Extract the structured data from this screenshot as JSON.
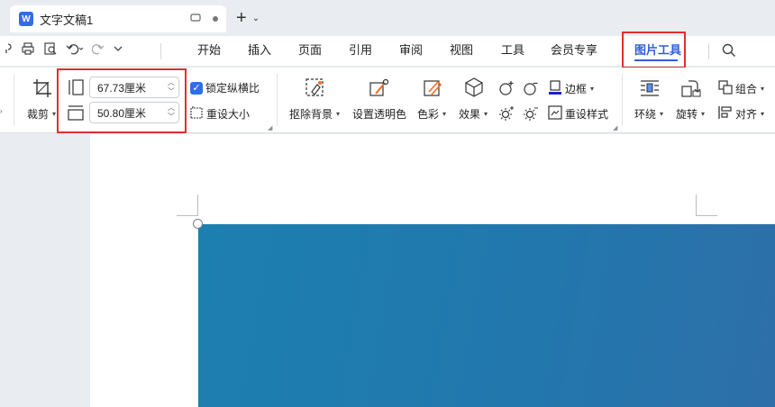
{
  "tab": {
    "logo": "W",
    "title": "文字文稿1",
    "icons": [
      "screen-icon",
      "dot-icon"
    ]
  },
  "newtab": {
    "plus": "+",
    "chevron": "⌄"
  },
  "menu": {
    "items": [
      "开始",
      "插入",
      "页面",
      "引用",
      "审阅",
      "视图",
      "工具",
      "会员专享",
      "图片工具"
    ],
    "active": "图片工具"
  },
  "ribbon": {
    "crop_label": "裁剪",
    "width_value": "67.73厘米",
    "height_value": "50.80厘米",
    "lock_ratio": "锁定纵横比",
    "reset_size": "重设大小",
    "remove_bg": "抠除背景",
    "set_transparent": "设置透明色",
    "color": "色彩",
    "effects": "效果",
    "border": "边框",
    "reset_style": "重设样式",
    "wrap": "环绕",
    "rotate": "旋转",
    "group": "组合",
    "align": "对齐"
  },
  "colors": {
    "accent": "#2f5fd8",
    "highlight_box": "#e0302f",
    "image_blue": "#1f7bb0"
  }
}
